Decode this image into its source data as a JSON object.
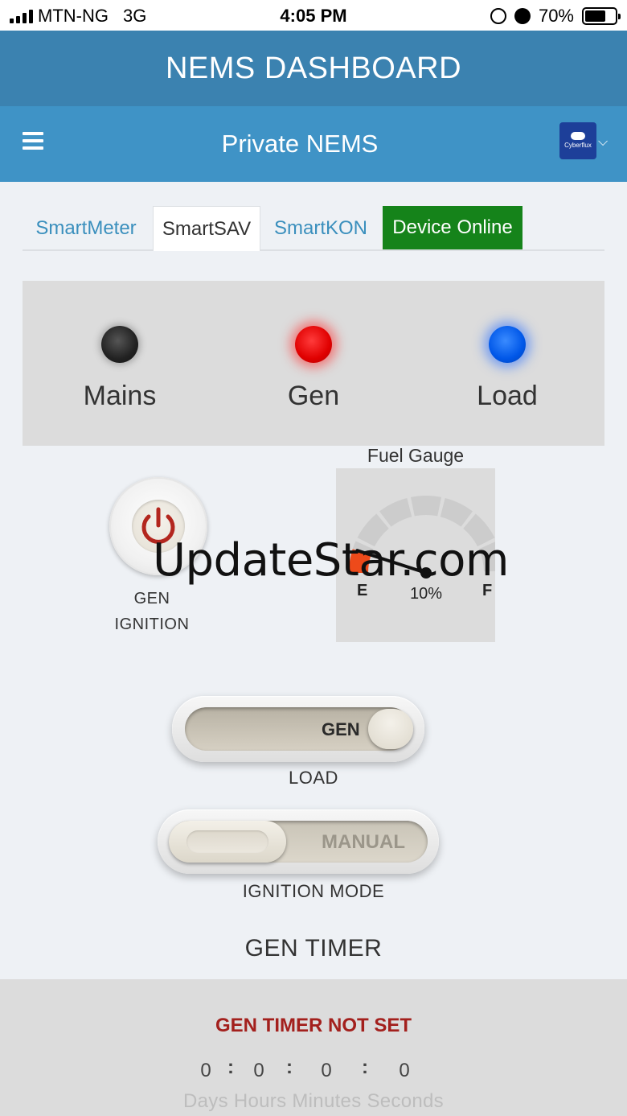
{
  "status_bar": {
    "carrier": "MTN-NG",
    "network": "3G",
    "time": "4:05 PM",
    "battery_percent": "70%",
    "battery_level": 0.7,
    "icons": [
      "signal-icon",
      "rotation-lock-icon",
      "alarm-icon",
      "battery-icon"
    ]
  },
  "app_header": {
    "title": "NEMS DASHBOARD"
  },
  "sub_header": {
    "title": "Private NEMS",
    "brand_logo_text": "Cyberflux"
  },
  "tabs": [
    {
      "label": "SmartMeter",
      "active": false
    },
    {
      "label": "SmartSAV",
      "active": true
    },
    {
      "label": "SmartKON",
      "active": false
    }
  ],
  "device_status": {
    "label": "Device Online",
    "color": "#15831a"
  },
  "indicators": [
    {
      "label": "Mains",
      "state": "off",
      "color": "#222222"
    },
    {
      "label": "Gen",
      "state": "on",
      "color": "#e00000"
    },
    {
      "label": "Load",
      "state": "on",
      "color": "#0057e8"
    }
  ],
  "ignition": {
    "label_line1": "GEN",
    "label_line2": "IGNITION",
    "icon": "power-icon"
  },
  "fuel_gauge": {
    "title": "Fuel Gauge",
    "empty_label": "E",
    "full_label": "F",
    "value_text": "10%",
    "level": 0.1
  },
  "watermark": "UpdateStar.com",
  "load_toggle": {
    "label": "LOAD",
    "value": "GEN"
  },
  "ignition_mode_toggle": {
    "label": "IGNITION MODE",
    "value": "MANUAL"
  },
  "gen_timer": {
    "title": "GEN TIMER",
    "status": "GEN TIMER NOT SET",
    "days": "0",
    "hours": "0",
    "minutes": "0",
    "seconds": "0",
    "units": "Days Hours Minutes Seconds"
  }
}
